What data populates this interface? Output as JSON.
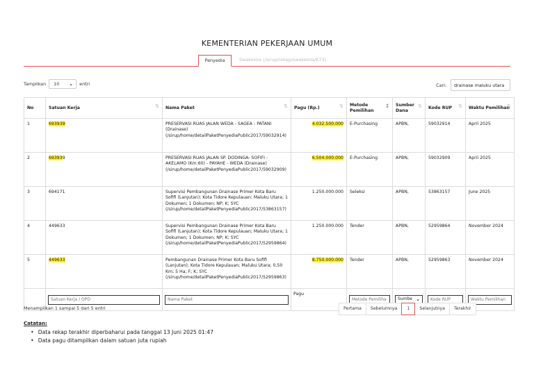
{
  "page": {
    "title": "KEMENTERIAN PEKERJAAN UMUM"
  },
  "tabs": [
    {
      "label": "Penyedia",
      "active": true
    },
    {
      "label": "Swakelola (/sirup/rekap/swakelola/K73)",
      "active": false
    }
  ],
  "length_menu": {
    "prefix": "Tampilkan",
    "value": "10",
    "suffix": "entri"
  },
  "search": {
    "label": "Cari:",
    "value": "drainase maluku utara"
  },
  "table": {
    "headers": [
      "No",
      "Satuan Kerja",
      "Nama Paket",
      "Pagu (Rp.)",
      "Metode Pemilihan",
      "Sumber Dana",
      "Kode RUP",
      "Waktu Pemilihan"
    ],
    "rows": [
      {
        "no": "1",
        "satker_hl": "693939",
        "satker_rest": "",
        "nama": "PRESERVASI RUAS JALAN WEDA - SAGEA - PATANI (Drainase) (/sirup/home/detailPaketPenyediaPublic2017/59032914)",
        "pagu": "4.032.500.000",
        "pagu_hl": true,
        "metode": "E-Purchasing",
        "sumber": "APBN,",
        "kode": "59032914",
        "waktu": "April 2025"
      },
      {
        "no": "2",
        "satker_hl": "69393",
        "satker_rest": "9",
        "nama": "PRESERVASI RUAS JALAN SP. DODINGA- SOFIFI - AKELAMO (Km.60) - PAYAHE - WEDA (Drainase) (/sirup/home/detailPaketPenyediaPublic2017/59032909)",
        "pagu": "6.504.000.000",
        "pagu_hl": true,
        "metode": "E-Purchasing",
        "sumber": "APBN,",
        "kode": "59032909",
        "waktu": "April 2025"
      },
      {
        "no": "3",
        "satker_hl": "",
        "satker_rest": "694171",
        "nama": "Supervisi Pembangunan Drainase Primer Kota Baru Sofifi (Lanjutan); Kota Tidore Kepulauan; Maluku Utara; 1 Dokumen; 1 Dokumen; NP; K; SYC (/sirup/home/detailPaketPenyediaPublic2017/53863157)",
        "pagu": "1.250.000.000",
        "pagu_hl": false,
        "metode": "Seleksi",
        "sumber": "APBN,",
        "kode": "53863157",
        "waktu": "June 2025"
      },
      {
        "no": "4",
        "satker_hl": "",
        "satker_rest": "449633",
        "nama": "Supervisi Pembangunan Drainase Primer Kota Baru Sofifi (Lanjutan); Kota Tidore Kepulauan; Maluku Utara; 1 Dokumen; 1 Dokumen; NP; K; SYC (/sirup/home/detailPaketPenyediaPublic2017/52959864)",
        "pagu": "1.250.000.000",
        "pagu_hl": false,
        "metode": "Tender",
        "sumber": "APBN,",
        "kode": "52959864",
        "waktu": "November 2024"
      },
      {
        "no": "5",
        "satker_hl": "449633",
        "satker_rest": "",
        "nama": "Pembangunan Drainase Primer Kota Baru Sofifi (Lanjutan); Kota Tidore Kepulauan; Maluku Utara; 0,50 Km; 5 Ha; F; K; SYC (/sirup/home/detailPaketPenyediaPublic2017/52959863)",
        "pagu": "8.750.000.000",
        "pagu_hl": true,
        "metode": "Tender",
        "sumber": "APBN,",
        "kode": "52959863",
        "waktu": "November 2024"
      }
    ],
    "filters": {
      "satker": "Satuan Kerja / OPD",
      "nama": "Nama Paket",
      "pagu": "Pagu",
      "metode": "Metode Pemiliha",
      "sumber": "Sumbe",
      "kode": "Kode RUP",
      "waktu": "Waktu Pemilihan"
    }
  },
  "info": "Menampilkan 1 sampai 5 dari 5 entri",
  "pagination": {
    "first": "Pertama",
    "prev": "Sebelumnya",
    "current": "1",
    "next": "Selanjutnya",
    "last": "Terakhir"
  },
  "notes": {
    "title": "Catatan:",
    "items": [
      "Data rekap terakhir diperbaharui pada tanggal 13 Juni 2025 01:47",
      "Data pagu ditampilkan dalam satuan juta rupiah"
    ]
  },
  "colors": {
    "accent": "#d9534f",
    "highlight": "#fff02a"
  }
}
